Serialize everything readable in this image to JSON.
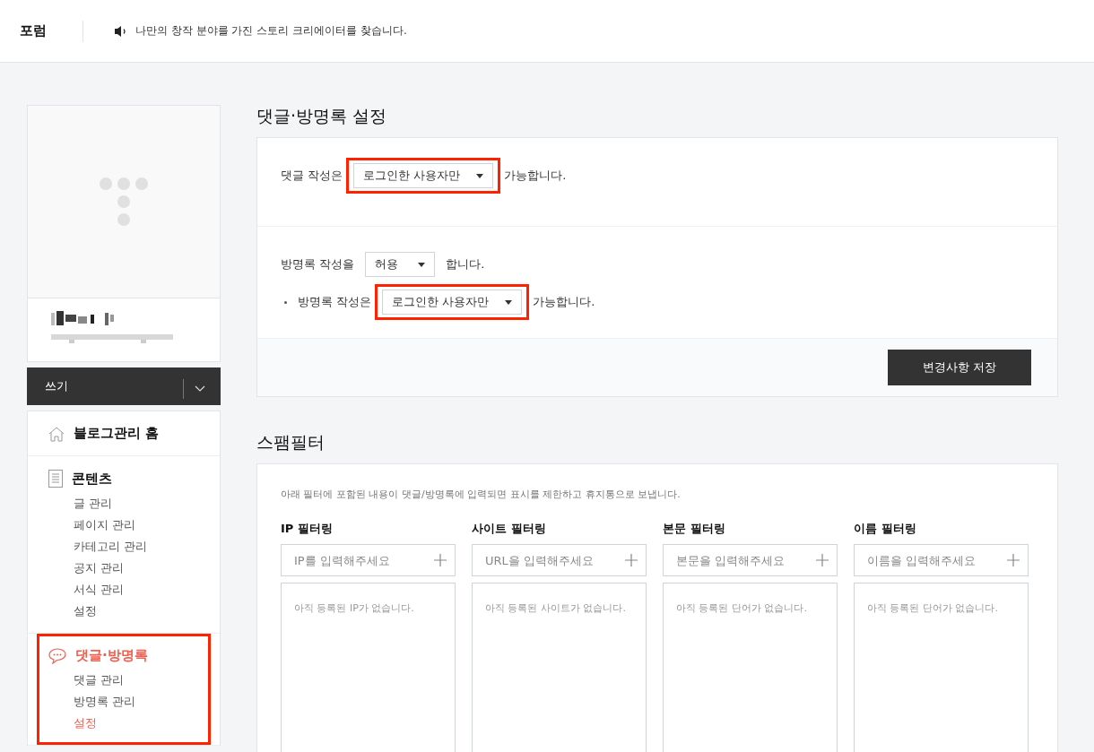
{
  "header": {
    "title": "포럼",
    "notice": "나만의 창작 분야를 가진 스토리 크리에이터를 찾습니다."
  },
  "sidebar": {
    "write_button": "쓰기",
    "menu": [
      {
        "kind": "home",
        "label": "블로그관리 홈",
        "selected": false,
        "highlighted": false
      },
      {
        "kind": "doc",
        "label": "콘텐츠",
        "selected": false,
        "highlighted": false,
        "children": [
          {
            "label": "글 관리",
            "selected": false
          },
          {
            "label": "페이지 관리",
            "selected": false
          },
          {
            "label": "카테고리 관리",
            "selected": false
          },
          {
            "label": "공지 관리",
            "selected": false
          },
          {
            "label": "서식 관리",
            "selected": false
          },
          {
            "label": "설정",
            "selected": false
          }
        ]
      },
      {
        "kind": "comment",
        "label": "댓글·방명록",
        "selected": true,
        "highlighted": true,
        "children": [
          {
            "label": "댓글 관리",
            "selected": false
          },
          {
            "label": "방명록 관리",
            "selected": false
          },
          {
            "label": "설정",
            "selected": true
          }
        ]
      }
    ]
  },
  "comment_settings": {
    "title": "댓글·방명록 설정",
    "rows": [
      {
        "lines": [
          {
            "bullet": false,
            "before": "댓글 작성은",
            "select": "로그인한 사용자만",
            "highlighted": true,
            "after": "가능합니다."
          }
        ]
      },
      {
        "lines": [
          {
            "bullet": false,
            "before": "방명록 작성을",
            "select": "허용",
            "highlighted": false,
            "after": "합니다."
          },
          {
            "bullet": true,
            "before": "방명록 작성은",
            "select": "로그인한 사용자만",
            "highlighted": true,
            "after": "가능합니다."
          }
        ]
      }
    ],
    "save_button": "변경사항 저장"
  },
  "spam_filter": {
    "title": "스팸필터",
    "description": "아래 필터에 포함된 내용이 댓글/방명록에 입력되면 표시를 제한하고 휴지통으로 보냅니다.",
    "filters": [
      {
        "label": "IP 필터링",
        "placeholder": "IP를 입력해주세요",
        "empty": "아직 등록된 IP가 없습니다."
      },
      {
        "label": "사이트 필터링",
        "placeholder": "URL을 입력해주세요",
        "empty": "아직 등록된 사이트가 없습니다."
      },
      {
        "label": "본문 필터링",
        "placeholder": "본문을 입력해주세요",
        "empty": "아직 등록된 단어가 없습니다."
      },
      {
        "label": "이름 필터링",
        "placeholder": "이름을 입력해주세요",
        "empty": "아직 등록된 단어가 없습니다."
      }
    ]
  }
}
